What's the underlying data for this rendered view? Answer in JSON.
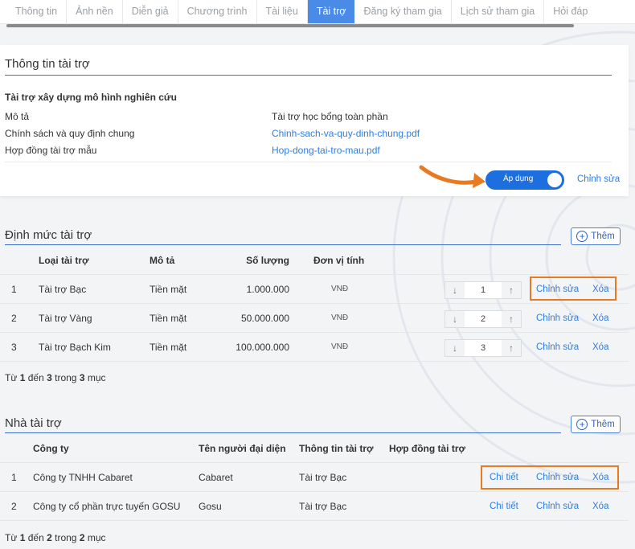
{
  "tabs": [
    {
      "label": "Thông tin",
      "active": false
    },
    {
      "label": "Ảnh nền",
      "active": false
    },
    {
      "label": "Diễn giả",
      "active": false
    },
    {
      "label": "Chương trình",
      "active": false
    },
    {
      "label": "Tài liệu",
      "active": false
    },
    {
      "label": "Tài trợ",
      "active": true
    },
    {
      "label": "Đăng ký tham gia",
      "active": false
    },
    {
      "label": "Lịch sử tham gia",
      "active": false
    },
    {
      "label": "Hỏi đáp",
      "active": false
    }
  ],
  "info": {
    "title": "Thông tin tài trợ",
    "heading": "Tài trợ xây dựng mô hình nghiên cứu",
    "description_label": "Mô tả",
    "description_value": "Tài trợ học bổng toàn phần",
    "policy_label": "Chính sách và quy định chung",
    "policy_file": "Chinh-sach-va-quy-dinh-chung.pdf",
    "contract_label": "Hợp đồng tài trợ mẫu",
    "contract_file": "Hop-dong-tai-tro-mau.pdf",
    "toggle_label": "Áp dụng",
    "toggle_on": true,
    "edit_label": "Chỉnh sửa"
  },
  "quota": {
    "title": "Định mức tài trợ",
    "add_label": "Thêm",
    "headers": {
      "type": "Loại tài trợ",
      "desc": "Mô tả",
      "qty": "Số lượng",
      "unit": "Đơn vị tính"
    },
    "rows": [
      {
        "no": "1",
        "type": "Tài trợ Bạc",
        "desc": "Tiền mặt",
        "qty": "1.000.000",
        "unit": "VNĐ",
        "order": "1",
        "edit": "Chỉnh sửa",
        "delete": "Xóa"
      },
      {
        "no": "2",
        "type": "Tài trợ Vàng",
        "desc": "Tiền mặt",
        "qty": "50.000.000",
        "unit": "VNĐ",
        "order": "2",
        "edit": "Chỉnh sửa",
        "delete": "Xóa"
      },
      {
        "no": "3",
        "type": "Tài trợ Bạch Kim",
        "desc": "Tiền mặt",
        "qty": "100.000.000",
        "unit": "VNĐ",
        "order": "3",
        "edit": "Chỉnh sửa",
        "delete": "Xóa"
      }
    ],
    "summary_prefix": "Từ ",
    "summary_from": "1",
    "summary_mid": " đến ",
    "summary_to": "3",
    "summary_mid2": " trong ",
    "summary_total": "3",
    "summary_suffix": " mục"
  },
  "sponsors": {
    "title": "Nhà tài trợ",
    "add_label": "Thêm",
    "headers": {
      "company": "Công ty",
      "rep": "Tên người đại diện",
      "info": "Thông tin tài trợ",
      "contract": "Hợp đồng tài trợ"
    },
    "rows": [
      {
        "no": "1",
        "company": "Công ty TNHH Cabaret",
        "rep": "Cabaret",
        "info": "Tài trợ Bạc",
        "detail": "Chi tiết",
        "edit": "Chỉnh sửa",
        "delete": "Xóa"
      },
      {
        "no": "2",
        "company": "Công ty cổ phần trực tuyến GOSU",
        "rep": "Gosu",
        "info": "Tài trợ Bạc",
        "detail": "Chi tiết",
        "edit": "Chỉnh sửa",
        "delete": "Xóa"
      }
    ],
    "summary_prefix": "Từ ",
    "summary_from": "1",
    "summary_mid": " đến ",
    "summary_to": "2",
    "summary_mid2": " trong ",
    "summary_total": "2",
    "summary_suffix": " mục"
  },
  "colors": {
    "accent": "#4a8be8",
    "toggle": "#1d6fe0",
    "link": "#2f7de1",
    "highlight": "#e87a22"
  },
  "icons": {
    "add": "plus-circle-icon",
    "down": "arrow-down-icon",
    "up": "arrow-up-icon",
    "pointer": "curved-arrow-icon"
  }
}
